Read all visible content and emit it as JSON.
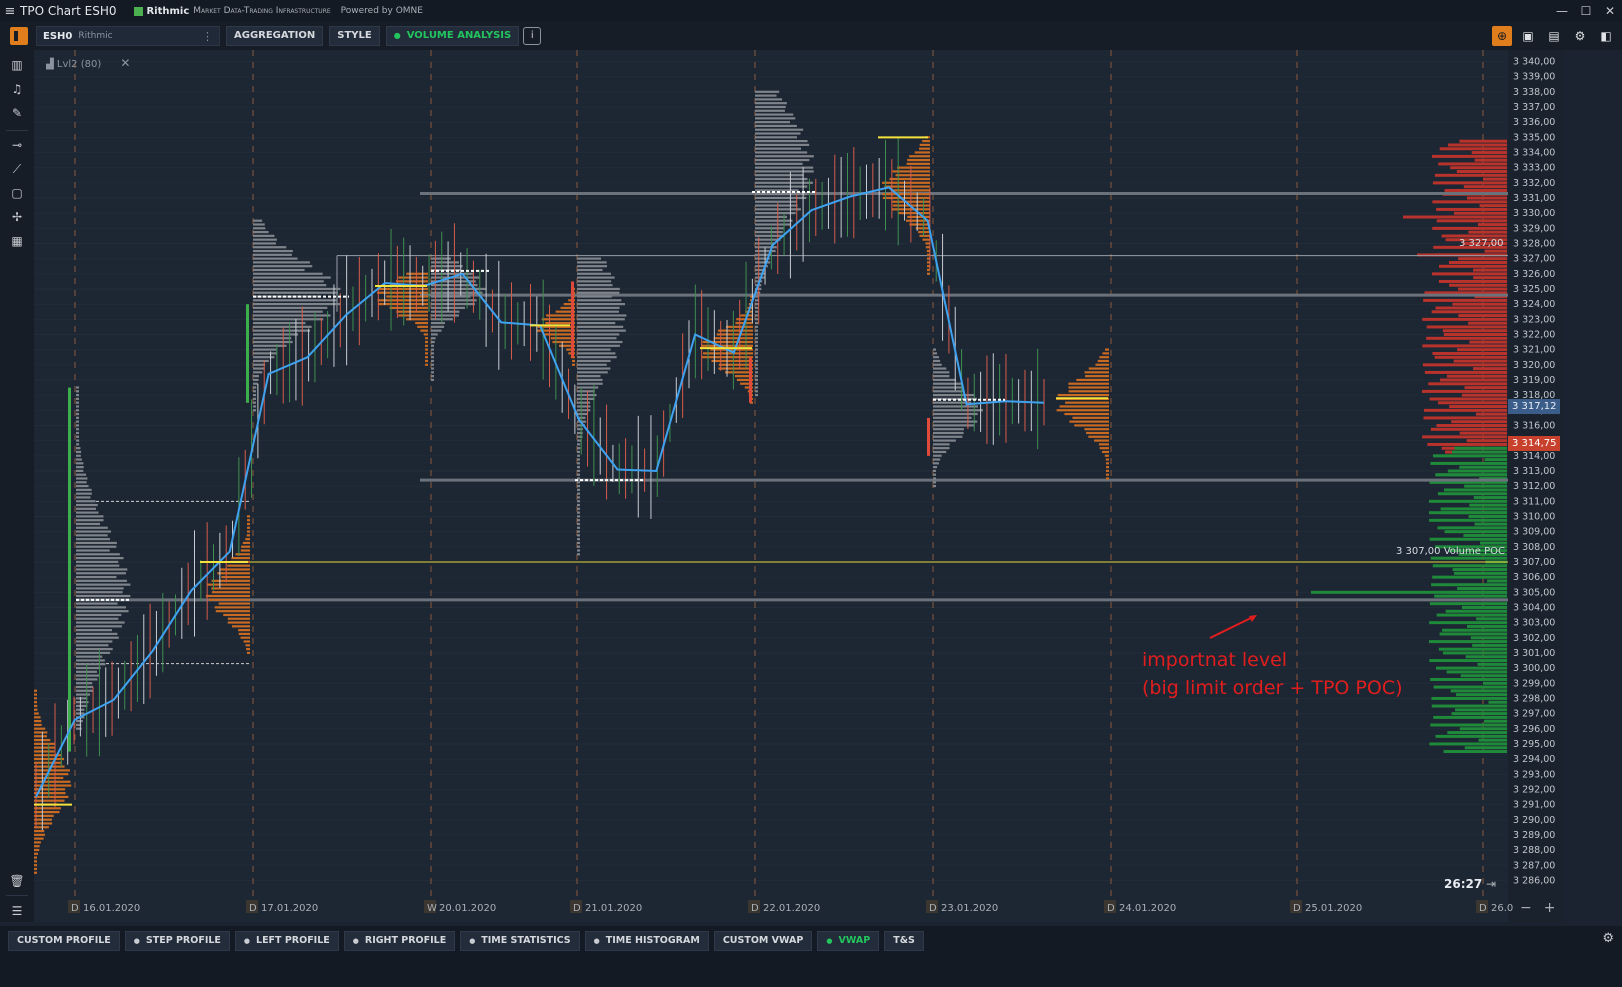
{
  "window": {
    "title": "TPO Chart ESH0",
    "brand": "Rithmic",
    "brand_tagline": "Market Data-Trading Infrastructure",
    "powered_by": "Powered by OMNE"
  },
  "toolbar": {
    "symbol": "ESH0",
    "connection": "Rithmic",
    "aggregation": "AGGREGATION",
    "style": "STYLE",
    "volume_analysis": "VOLUME ANALYSIS"
  },
  "indicator_label": "Lvl2 (80)",
  "price_axis": {
    "min": 3285.5,
    "max": 3340.5,
    "labels": [
      "3 340,00",
      "3 339,00",
      "3 338,00",
      "3 337,00",
      "3 336,00",
      "3 335,00",
      "3 334,00",
      "3 333,00",
      "3 332,00",
      "3 331,00",
      "3 330,00",
      "3 329,00",
      "3 328,00",
      "3 327,00",
      "3 326,00",
      "3 325,00",
      "3 324,00",
      "3 323,00",
      "3 322,00",
      "3 321,00",
      "3 320,00",
      "3 319,00",
      "3 318,00",
      "3 317,00",
      "3 316,00",
      "3 315,00",
      "3 314,00",
      "3 313,00",
      "3 312,00",
      "3 311,00",
      "3 310,00",
      "3 309,00",
      "3 308,00",
      "3 307,00",
      "3 306,00",
      "3 305,00",
      "3 304,00",
      "3 303,00",
      "3 302,00",
      "3 301,00",
      "3 300,00",
      "3 299,00",
      "3 298,00",
      "3 297,00",
      "3 296,00",
      "3 295,00",
      "3 294,00",
      "3 293,00",
      "3 292,00",
      "3 291,00",
      "3 290,00",
      "3 289,00",
      "3 288,00",
      "3 287,00",
      "3 286,00"
    ],
    "current_price": "3 317,12",
    "bid_price": "3 314,75",
    "level_3327": "3 327,00",
    "volume_poc_label": "3 307,00 Volume POC"
  },
  "date_axis": [
    {
      "tag": "D",
      "label": "16.01.2020"
    },
    {
      "tag": "D",
      "label": "17.01.2020"
    },
    {
      "tag": "W",
      "label": "20.01.2020"
    },
    {
      "tag": "D",
      "label": "21.01.2020"
    },
    {
      "tag": "D",
      "label": "22.01.2020"
    },
    {
      "tag": "D",
      "label": "23.01.2020"
    },
    {
      "tag": "D",
      "label": "24.01.2020"
    },
    {
      "tag": "D",
      "label": "25.01.2020"
    },
    {
      "tag": "D",
      "label": "26.0"
    }
  ],
  "annotation": {
    "line1": "importnat level",
    "line2": "(big limit order + TPO POC)"
  },
  "timer": "26:27",
  "chart_data": {
    "type": "line",
    "series": [
      {
        "values": [
          3291.5,
          3296.6,
          3297.9,
          3301.1,
          3305.1,
          3307.7,
          3319.4,
          3320.5,
          3323.3,
          3325.4,
          3325.2,
          3326.0,
          3322.8,
          3322.6,
          3316.4,
          3313.1,
          3313.0,
          3322.0,
          3320.8,
          3327.9,
          3330.2,
          3331.1,
          3331.7,
          3329.5,
          3317.4,
          3317.6,
          3317.5
        ]
      }
    ],
    "levels": {
      "volume_poc": 3307.0,
      "tpo_poc_important": 3304.5,
      "grey_levels": [
        3331.3,
        3324.6,
        3312.4
      ],
      "value_area_high_day1": 3311.0,
      "value_area_low_day1": 3300.3,
      "white_thin_level": 3327.2
    }
  },
  "bottom_tabs": [
    "CUSTOM PROFILE",
    "STEP PROFILE",
    "LEFT PROFILE",
    "RIGHT PROFILE",
    "TIME STATISTICS",
    "TIME HISTOGRAM",
    "CUSTOM VWAP",
    "VWAP",
    "T&S"
  ],
  "colors": {
    "accent": "#e07d1d",
    "vwap": "#3fa2f0",
    "poc_yellow": "#f5e33d",
    "ask_red": "#c7412d",
    "bid_green": "#1f8a3a",
    "tpo_grey": "#8a8e94",
    "volume_orange": "#c86a22"
  }
}
